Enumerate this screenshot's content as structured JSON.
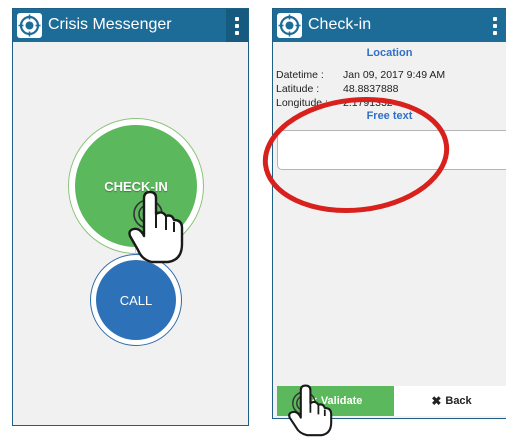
{
  "left_screen": {
    "app_title": "Crisis Messenger",
    "checkin_label": "CHECK-IN",
    "call_label": "CALL"
  },
  "right_screen": {
    "app_title": "Check-in",
    "location_heading": "Location",
    "datetime_label": "Datetime :",
    "datetime_value": "Jan 09, 2017 9:49 AM",
    "latitude_label": "Latitude :",
    "latitude_value": "48.8837888",
    "longitude_label": "Longitude :",
    "longitude_value": "2.1791332",
    "free_text_heading": "Free text",
    "free_text_value": "",
    "validate_label": "Validate",
    "back_label": "Back"
  },
  "icons": [
    "app-logo-icon",
    "kebab-menu-icon",
    "pointing-hand-icon",
    "checkmark-icon",
    "close-x-icon"
  ],
  "colors": {
    "appbar": "#1d6c98",
    "checkin_green": "#5cb85c",
    "call_blue": "#2d72b8",
    "heading_blue": "#3070c8",
    "annotation_red": "#d8201c"
  }
}
